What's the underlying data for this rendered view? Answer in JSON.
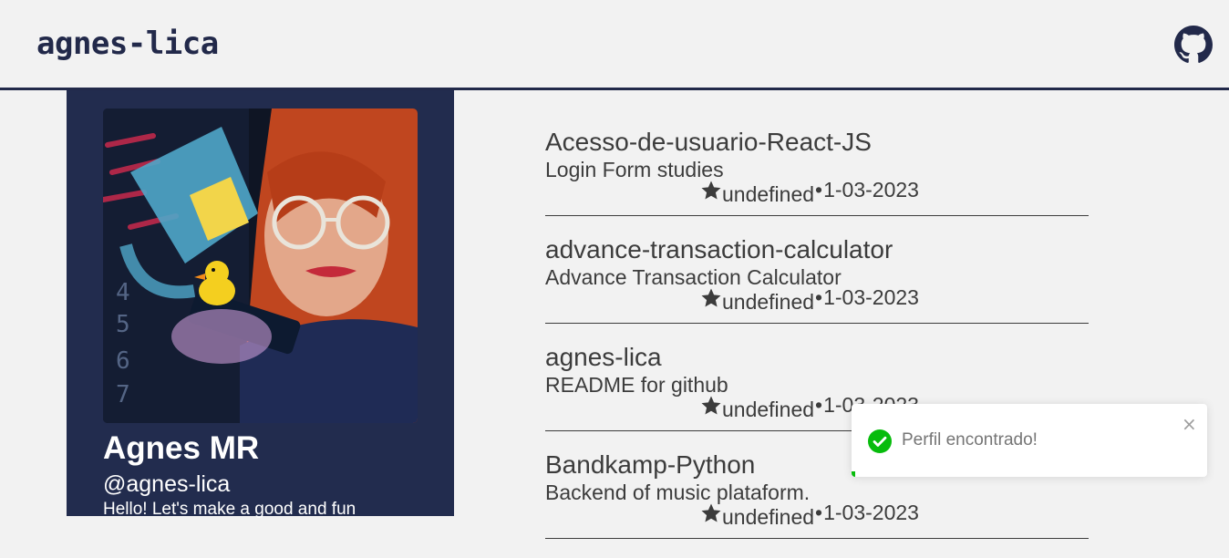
{
  "header": {
    "brand": "agnes-lica",
    "github_icon": "github-icon"
  },
  "profile": {
    "avatar_icon": "profile-photo",
    "name": "Agnes MR",
    "login": "@agnes-lica",
    "bio": "Hello! Let's make a good and fun"
  },
  "repos": [
    {
      "name": "Acesso-de-usuario-React-JS",
      "description": "Login Form studies",
      "stars": "undefined",
      "separator": "•",
      "date": "1-03-2023"
    },
    {
      "name": "advance-transaction-calculator",
      "description": "Advance Transaction Calculator",
      "stars": "undefined",
      "separator": "•",
      "date": "1-03-2023"
    },
    {
      "name": "agnes-lica",
      "description": "README for github",
      "stars": "undefined",
      "separator": "•",
      "date": "1-03-2023"
    },
    {
      "name": "Bandkamp-Python",
      "description": "Backend of music plataform.",
      "stars": "undefined",
      "separator": "•",
      "date": "1-03-2023"
    }
  ],
  "toast": {
    "message": "Perfil encontrado!",
    "close_label": "×",
    "progress": 0.01,
    "colors": {
      "success": "#07bc0c"
    }
  },
  "colors": {
    "navy": "#22294a",
    "card": "#222c4e",
    "background": "#f2f2f2",
    "text": "#3c3c3c"
  }
}
